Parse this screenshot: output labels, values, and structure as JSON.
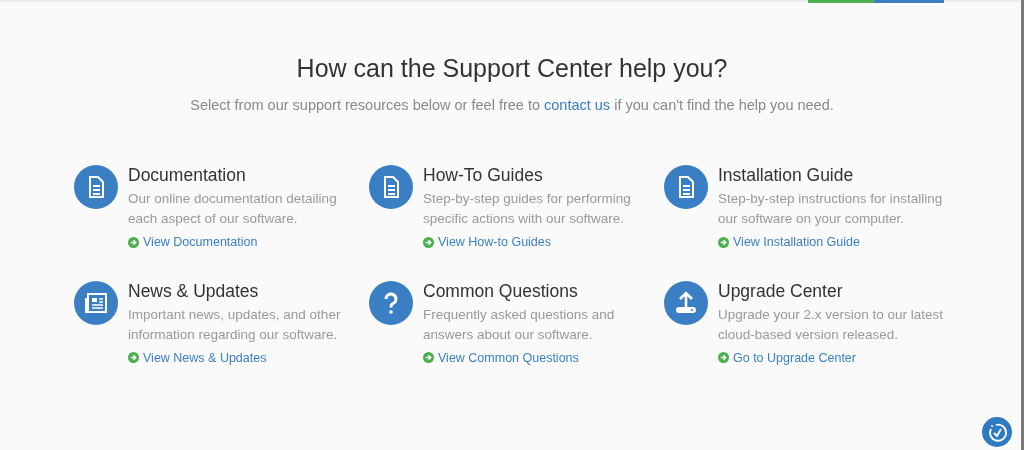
{
  "heading": "How can the Support Center help you?",
  "intro_parts": {
    "before": "Select from our support resources below or feel free to",
    "link": "contact us",
    "after": "if you can't find the help you need."
  },
  "cards": [
    {
      "kind": "document",
      "title": "Documentation",
      "description": "Our online documentation detailing each aspect of our software.",
      "link": "View Documentation"
    },
    {
      "kind": "document",
      "title": "How-To Guides",
      "description": "Step-by-step guides for performing specific actions with our software.",
      "link": "View How-to Guides"
    },
    {
      "kind": "document",
      "title": "Installation Guide",
      "description": "Step-by-step instructions for installing our software on your computer.",
      "link": "View Installation Guide"
    },
    {
      "kind": "news",
      "title": "News & Updates",
      "description": "Important news, updates, and other information regarding our software.",
      "link": "View News & Updates"
    },
    {
      "kind": "question",
      "title": "Common Questions",
      "description": "Frequently asked questions and answers about our software.",
      "link": "View Common Questions"
    },
    {
      "kind": "upload",
      "title": "Upgrade Center",
      "description": "Upgrade your 2.x version to our latest cloud-based version released.",
      "link": "Go to Upgrade Center"
    }
  ]
}
